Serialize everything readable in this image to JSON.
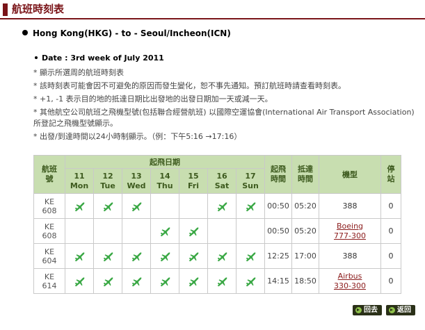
{
  "title": "航班時刻表",
  "route": "Hong Kong(HKG) - to - Seoul/Incheon(ICN)",
  "date_label": "Date : 3rd week of July 2011",
  "notes": [
    "* 顯示所選周的航班時刻表",
    "* 該時刻表可能會因不可避免的原因而發生變化，恕不事先通知。預訂航班時請查看時刻表。",
    "* +1, -1 表示目的地的抵達日期比出發地的出發日期加一天或減一天。",
    "* 其他航空公司航班之飛機型號(包括聯合經營航班) 以國際空運協會(International Air Transport Association) 所登記之飛機型號顯示。",
    "* 出發/到達時間以24小時制顯示。（例：下午5:16 →17:16）"
  ],
  "table": {
    "flight_header": "航班號",
    "dep_date_header": "起飛日期",
    "dep_time_header": "起飛時間",
    "arr_time_header": "抵達時間",
    "model_header": "機型",
    "stops_header": "停站",
    "days": [
      {
        "num": "11",
        "name": "Mon"
      },
      {
        "num": "12",
        "name": "Tue"
      },
      {
        "num": "13",
        "name": "Wed"
      },
      {
        "num": "14",
        "name": "Thu"
      },
      {
        "num": "15",
        "name": "Fri"
      },
      {
        "num": "16",
        "name": "Sat"
      },
      {
        "num": "17",
        "name": "Sun"
      }
    ],
    "rows": [
      {
        "carrier": "KE",
        "number": "608",
        "days": [
          1,
          1,
          1,
          0,
          0,
          1,
          1
        ],
        "dep": "00:50",
        "arr": "05:20",
        "model": "388",
        "model_link": false,
        "stops": "0"
      },
      {
        "carrier": "KE",
        "number": "608",
        "days": [
          0,
          0,
          0,
          1,
          1,
          0,
          0
        ],
        "dep": "00:50",
        "arr": "05:20",
        "model": "Boeing 777-300",
        "model_link": true,
        "stops": "0"
      },
      {
        "carrier": "KE",
        "number": "604",
        "days": [
          1,
          1,
          1,
          1,
          1,
          1,
          1
        ],
        "dep": "12:25",
        "arr": "17:00",
        "model": "388",
        "model_link": false,
        "stops": "0"
      },
      {
        "carrier": "KE",
        "number": "614",
        "days": [
          1,
          1,
          1,
          1,
          1,
          1,
          1
        ],
        "dep": "14:15",
        "arr": "18:50",
        "model": "Airbus 330-300",
        "model_link": true,
        "stops": "0"
      }
    ]
  },
  "buttons": {
    "back": "回去",
    "return": "返回"
  },
  "colors": {
    "title": "#7a1418",
    "header_bg": "#c8deb0",
    "plane": "#3aa845"
  },
  "icons": {
    "flight": "plane-icon"
  }
}
